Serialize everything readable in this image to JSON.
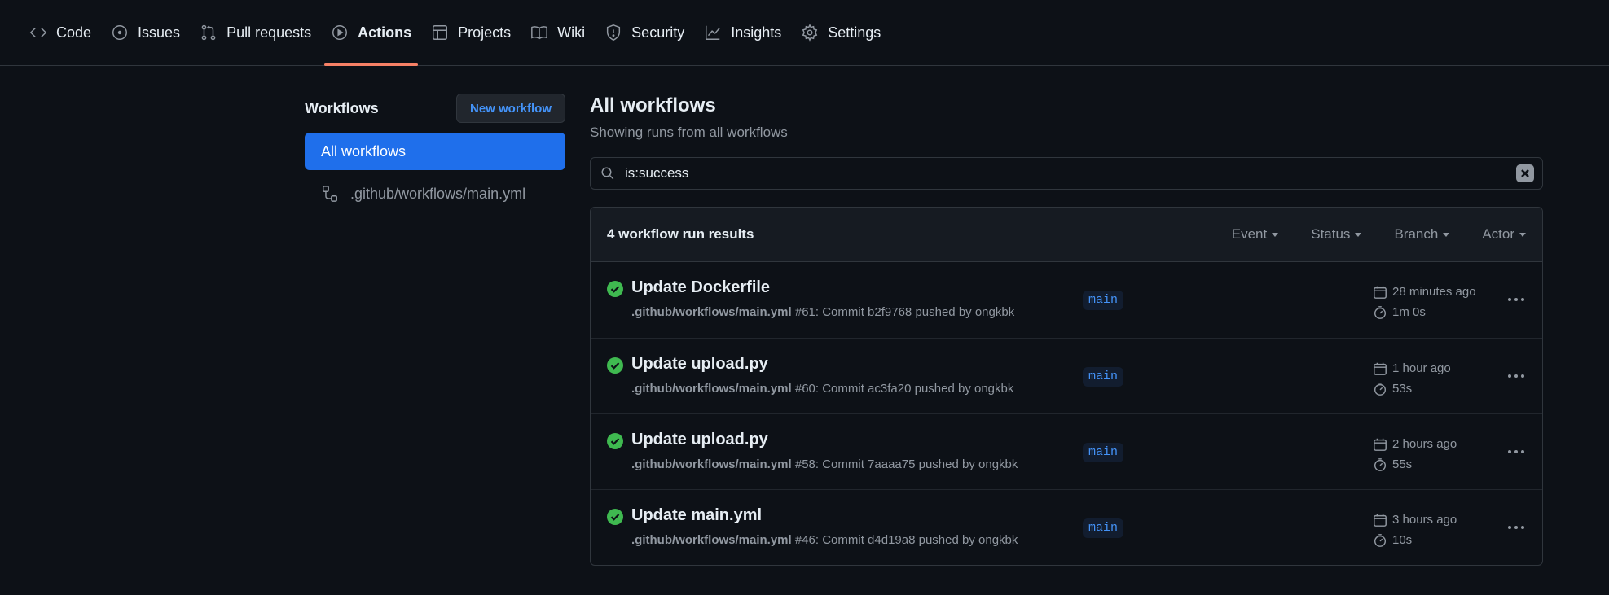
{
  "nav": {
    "tabs": [
      {
        "label": "Code",
        "icon": "code-icon"
      },
      {
        "label": "Issues",
        "icon": "issue-icon"
      },
      {
        "label": "Pull requests",
        "icon": "pull-request-icon"
      },
      {
        "label": "Actions",
        "icon": "play-icon",
        "active": true
      },
      {
        "label": "Projects",
        "icon": "table-icon"
      },
      {
        "label": "Wiki",
        "icon": "book-icon"
      },
      {
        "label": "Security",
        "icon": "shield-icon"
      },
      {
        "label": "Insights",
        "icon": "graph-icon"
      },
      {
        "label": "Settings",
        "icon": "gear-icon"
      }
    ],
    "active_underline_color": "#f78166"
  },
  "sidebar": {
    "title": "Workflows",
    "new_button": "New workflow",
    "items": [
      {
        "label": "All workflows",
        "active": true
      },
      {
        "label": ".github/workflows/main.yml",
        "icon": "workflow-icon"
      }
    ]
  },
  "main": {
    "title": "All workflows",
    "subtitle": "Showing runs from all workflows",
    "search_value": "is:success",
    "results_count": "4 workflow run results",
    "filters": [
      "Event",
      "Status",
      "Branch",
      "Actor"
    ],
    "runs": [
      {
        "title": "Update Dockerfile",
        "workflow": ".github/workflows/main.yml",
        "detail": "#61: Commit b2f9768 pushed by ongkbk",
        "branch": "main",
        "when": "28 minutes ago",
        "duration": "1m 0s"
      },
      {
        "title": "Update upload.py",
        "workflow": ".github/workflows/main.yml",
        "detail": "#60: Commit ac3fa20 pushed by ongkbk",
        "branch": "main",
        "when": "1 hour ago",
        "duration": "53s"
      },
      {
        "title": "Update upload.py",
        "workflow": ".github/workflows/main.yml",
        "detail": "#58: Commit 7aaaa75 pushed by ongkbk",
        "branch": "main",
        "when": "2 hours ago",
        "duration": "55s"
      },
      {
        "title": "Update main.yml",
        "workflow": ".github/workflows/main.yml",
        "detail": "#46: Commit d4d19a8 pushed by ongkbk",
        "branch": "main",
        "when": "3 hours ago",
        "duration": "10s"
      }
    ]
  },
  "colors": {
    "background": "#0d1117",
    "accent": "#1f6feb",
    "success": "#3fb950",
    "link": "#4493f8"
  }
}
